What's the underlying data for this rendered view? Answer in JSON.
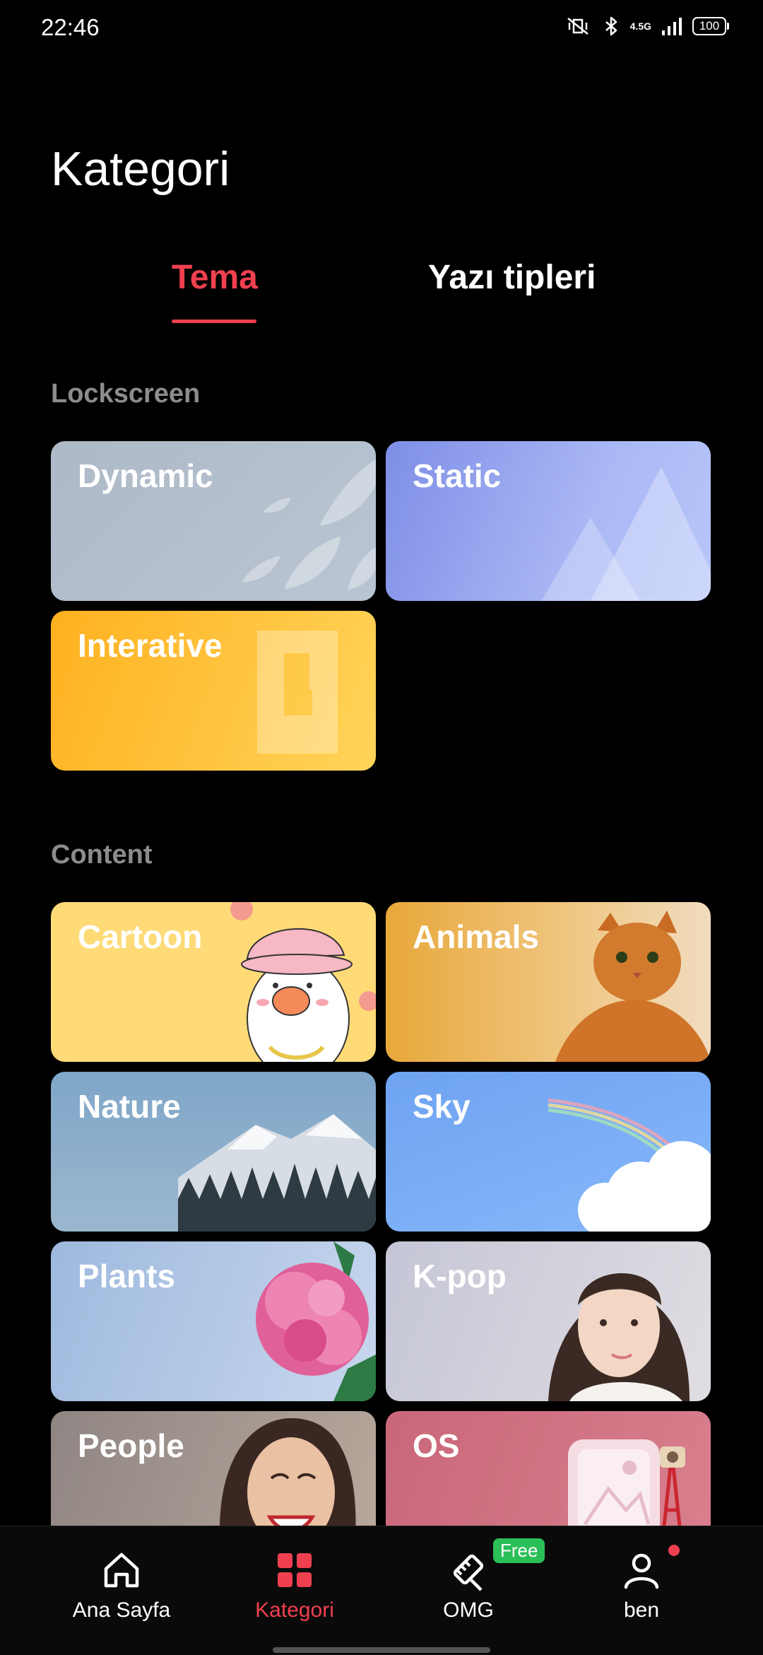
{
  "status_bar": {
    "time": "22:46",
    "network": "4.5G",
    "battery": "100"
  },
  "page": {
    "title": "Kategori"
  },
  "tabs": [
    {
      "label": "Tema",
      "active": true
    },
    {
      "label": "Yazı tipleri",
      "active": false
    }
  ],
  "sections": {
    "lockscreen": {
      "title": "Lockscreen",
      "items": [
        "Dynamic",
        "Static",
        "Interative"
      ]
    },
    "content": {
      "title": "Content",
      "items": [
        "Cartoon",
        "Animals",
        "Nature",
        "Sky",
        "Plants",
        "K-pop",
        "People",
        "OS"
      ]
    }
  },
  "bottom_nav": [
    {
      "label": "Ana Sayfa",
      "icon": "home-icon"
    },
    {
      "label": "Kategori",
      "icon": "grid-icon",
      "active": true
    },
    {
      "label": "OMG",
      "icon": "ruler-pencil-icon",
      "badge": "Free"
    },
    {
      "label": "ben",
      "icon": "user-icon",
      "dot": true
    }
  ],
  "colors": {
    "accent": "#f0404f",
    "badge_green": "#2bbf58",
    "background": "#000000"
  }
}
